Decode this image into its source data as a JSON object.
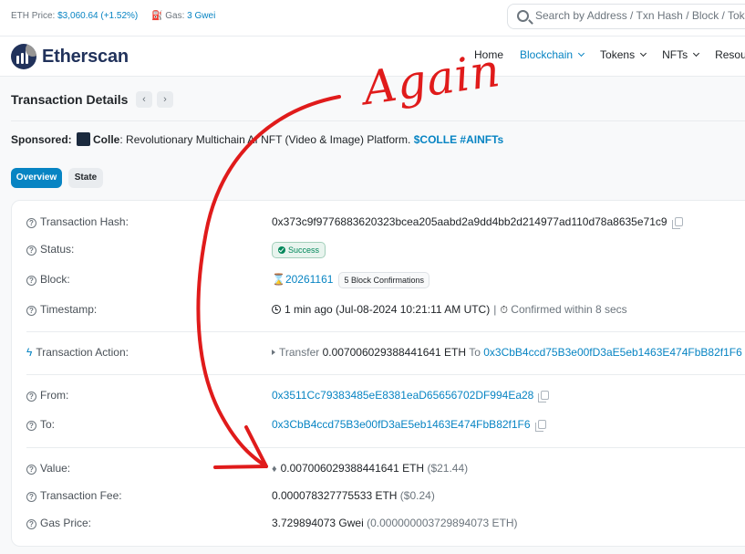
{
  "topbar": {
    "eth_price_label": "ETH Price:",
    "eth_price_value": "$3,060.64 (+1.52%)",
    "gas_label": "Gas:",
    "gas_value": "3 Gwei",
    "search_placeholder": "Search by Address / Txn Hash / Block / Token"
  },
  "navbar": {
    "logo_text": "Etherscan",
    "items": [
      {
        "label": "Home",
        "active": false,
        "dropdown": false
      },
      {
        "label": "Blockchain",
        "active": true,
        "dropdown": true
      },
      {
        "label": "Tokens",
        "active": false,
        "dropdown": true
      },
      {
        "label": "NFTs",
        "active": false,
        "dropdown": true
      },
      {
        "label": "Resources",
        "active": false,
        "dropdown": false
      }
    ]
  },
  "page": {
    "title": "Transaction Details",
    "prev_arrow": "‹",
    "next_arrow": "›"
  },
  "sponsor": {
    "label": "Sponsored:",
    "name": "Colle",
    "text": ": Revolutionary Multichain AI NFT (Video & Image) Platform.",
    "hashtags": "$COLLE #AINFTs"
  },
  "tabs": {
    "overview": "Overview",
    "state": "State"
  },
  "details": {
    "tx_hash_label": "Transaction Hash:",
    "tx_hash": "0x373c9f9776883620323bcea205aabd2a9dd4bb2d214977ad110d78a8635e71c9",
    "status_label": "Status:",
    "status": "Success",
    "block_label": "Block:",
    "block": "20261161",
    "block_confirmations": "5 Block Confirmations",
    "timestamp_label": "Timestamp:",
    "timestamp": "1 min ago (Jul-08-2024 10:21:11 AM UTC)",
    "confirmed": "Confirmed within 8 secs",
    "action_label": "Transaction Action:",
    "action_prefix": "Transfer",
    "action_amount": "0.007006029388441641 ETH",
    "action_to": "To",
    "action_to_address": "0x3CbB4ccd75B3e00fD3aE5eb1463E474FbB82f1F6",
    "from_label": "From:",
    "from": "0x3511Cc79383485eE8381eaD65656702DF994Ea28",
    "to_label": "To:",
    "to": "0x3CbB4ccd75B3e00fD3aE5eb1463E474FbB82f1F6",
    "value_label": "Value:",
    "value": "0.007006029388441641 ETH",
    "value_usd": "($21.44)",
    "fee_label": "Transaction Fee:",
    "fee": "0.000078327775533 ETH",
    "fee_usd": "($0.24)",
    "gas_price_label": "Gas Price:",
    "gas_price": "3.729894073 Gwei",
    "gas_price_eth": "(0.000000003729894073 ETH)"
  },
  "annotation": {
    "text": "Again",
    "color": "#e01b1b"
  },
  "colors": {
    "accent": "#0784c3",
    "success": "#00875a",
    "brand": "#21325b"
  }
}
